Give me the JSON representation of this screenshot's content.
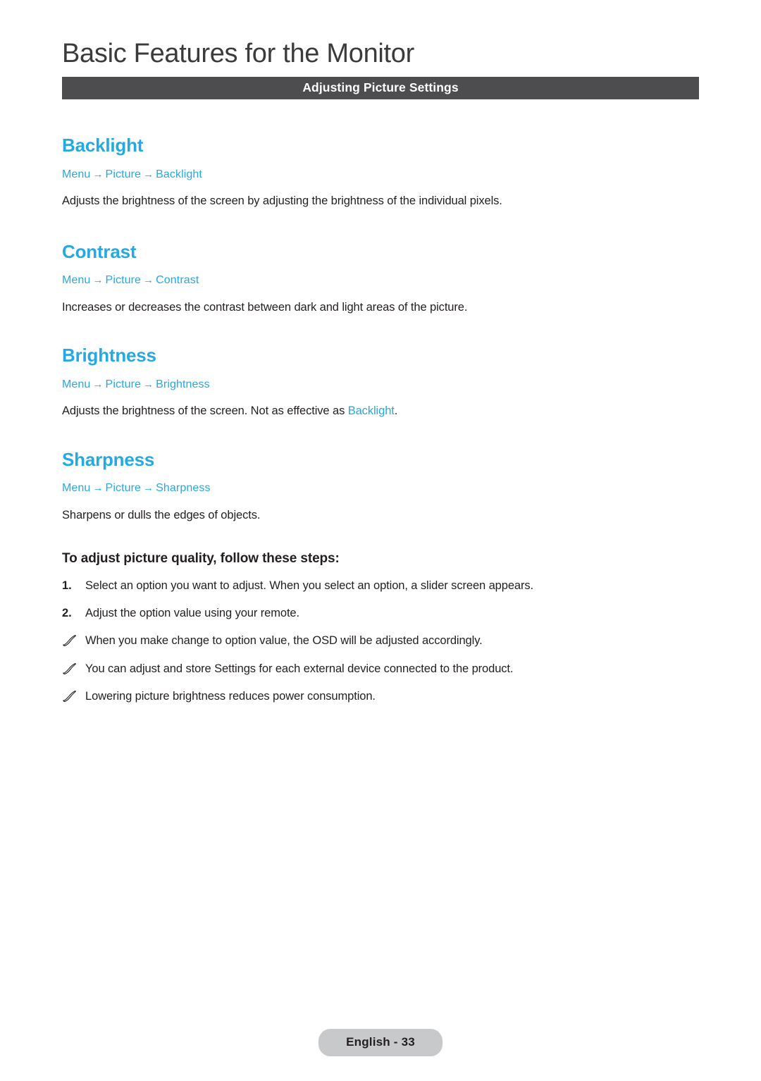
{
  "header": {
    "chapter_title": "Basic Features for the Monitor",
    "section_title": "Adjusting Picture Settings",
    "bar_color": "#4d4d4f"
  },
  "accent_color": "#26a9e0",
  "features": [
    {
      "title": "Backlight",
      "breadcrumb": [
        "Menu",
        "Picture",
        "Backlight"
      ],
      "description": "Adjusts the brightness of the screen by adjusting the brightness of the individual pixels."
    },
    {
      "title": "Contrast",
      "breadcrumb": [
        "Menu",
        "Picture",
        "Contrast"
      ],
      "description": "Increases or decreases the contrast between dark and light areas of the picture."
    },
    {
      "title": "Brightness",
      "breadcrumb": [
        "Menu",
        "Picture",
        "Brightness"
      ],
      "description_pre": "Adjusts the brightness of the screen. Not as effective as ",
      "description_highlight": "Backlight",
      "description_post": "."
    },
    {
      "title": "Sharpness",
      "breadcrumb": [
        "Menu",
        "Picture",
        "Sharpness"
      ],
      "description": "Sharpens or dulls the edges of objects."
    }
  ],
  "steps_section": {
    "title": "To adjust picture quality, follow these steps:",
    "steps": [
      {
        "num": "1.",
        "text": "Select an option you want to adjust. When you select an option, a slider screen appears."
      },
      {
        "num": "2.",
        "text": "Adjust the option value using your remote."
      }
    ],
    "notes": [
      "When you make change to option value, the OSD will be adjusted accordingly.",
      "You can adjust and store Settings for each external device connected to the product.",
      "Lowering picture brightness reduces power consumption."
    ]
  },
  "footer": {
    "page_label": "English - 33"
  }
}
